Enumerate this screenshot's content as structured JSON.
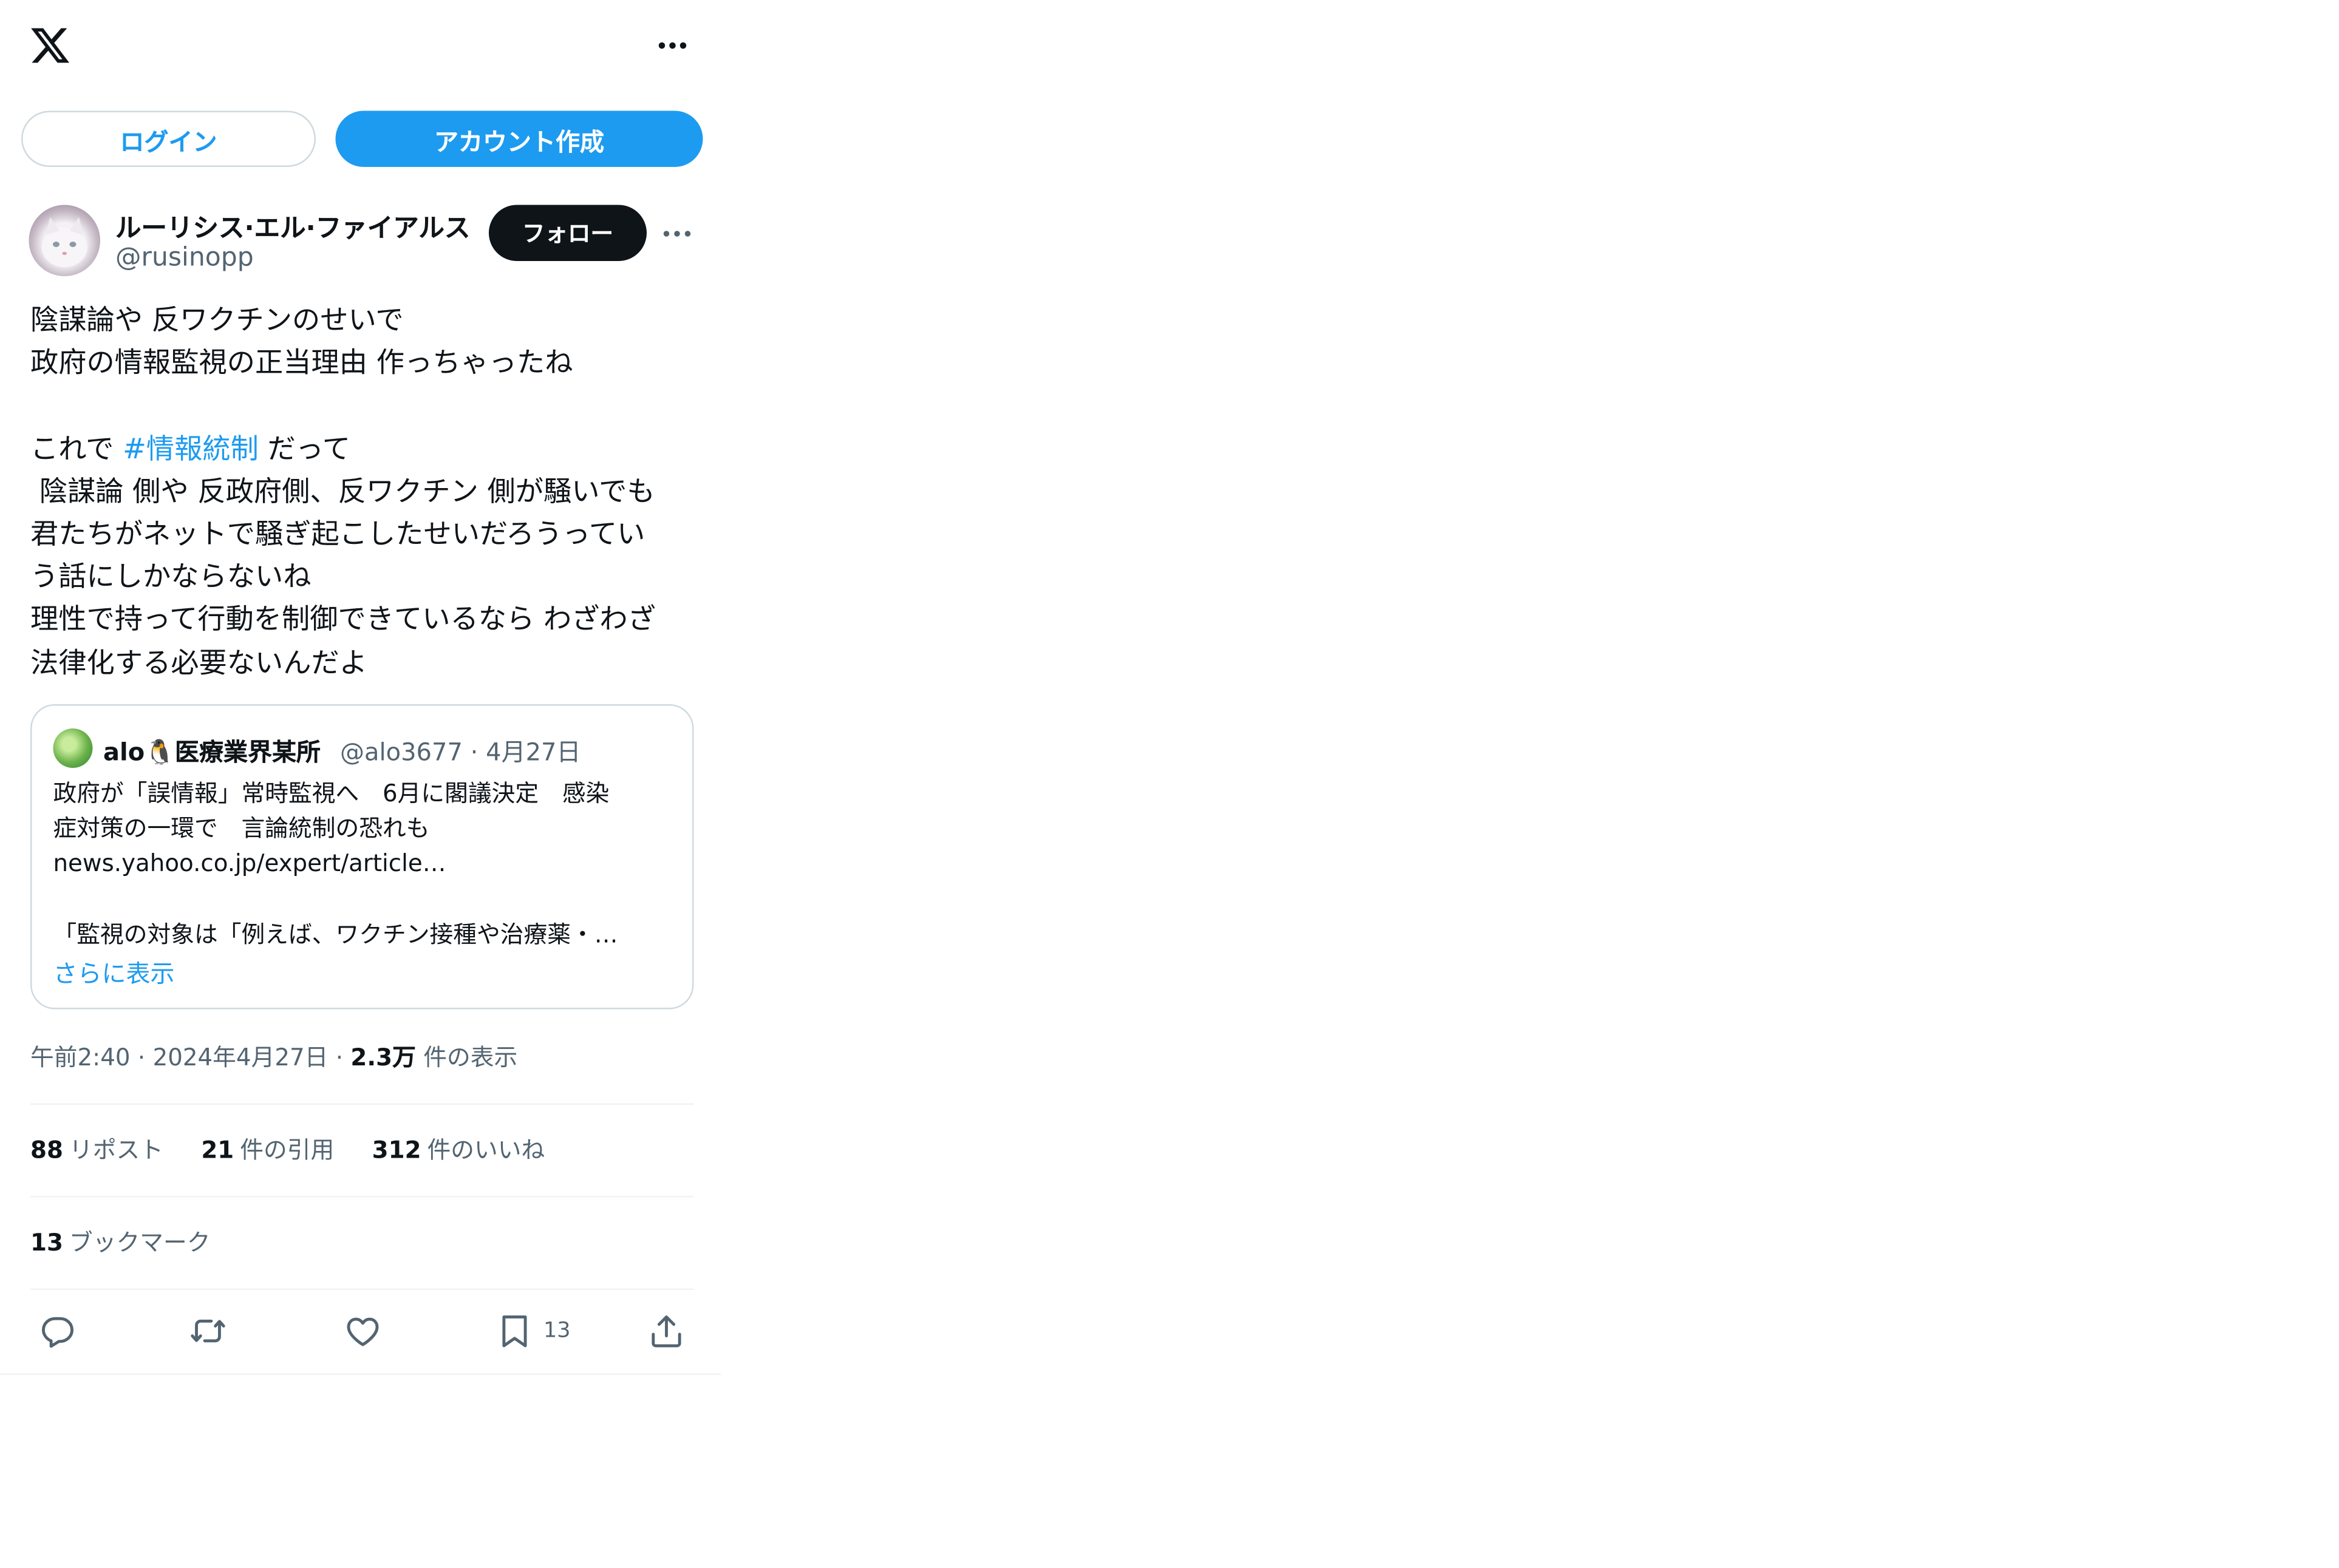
{
  "header": {
    "logo_icon": "x-logo-icon",
    "more_icon": "more-horizontal-icon"
  },
  "auth": {
    "login_label": "ログイン",
    "signup_label": "アカウント作成"
  },
  "post": {
    "author": {
      "display_name": "ルーリシス·エル·ファイアルス",
      "handle": "@rusinopp"
    },
    "follow_label": "フォロー",
    "body": {
      "line1": "陰謀論や 反ワクチンのせいで",
      "line2": "政府の情報監視の正当理由 作っちゃったね",
      "line3_before": "これで ",
      "hashtag": "#情報統制",
      "line3_after": " だって",
      "line4": " 陰謀論 側や 反政府側、反ワクチン 側が騒いでも",
      "line5": "君たちがネットで騒ぎ起こしたせいだろうってい",
      "line6": "う話にしかならないね",
      "line7": "理性で持って行動を制御できているなら わざわざ",
      "line8": "法律化する必要ないんだよ"
    },
    "quote": {
      "name": "alo🐧医療業界某所",
      "handle": "@alo3677",
      "separator": "·",
      "date": "4月27日",
      "line1": "政府が「誤情報」常時監視へ　6月に閣議決定　感染",
      "line2": "症対策の一環で　言論統制の恐れも",
      "line3": "news.yahoo.co.jp/expert/article…",
      "line4": "「監視の対象は「例えば、ワクチン接種や治療薬・…",
      "show_more": "さらに表示"
    },
    "timestamp": {
      "time": "午前2:40",
      "dot1": "·",
      "date": "2024年4月27日",
      "dot2": "·",
      "views": "2.3万",
      "views_label": "件の表示"
    },
    "stats": {
      "reposts": "88",
      "reposts_label": "リポスト",
      "quotes": "21",
      "quotes_label": "件の引用",
      "likes": "312",
      "likes_label": "件のいいね",
      "bookmarks": "13",
      "bookmarks_label": "ブックマーク"
    },
    "actions": {
      "reply_icon": "reply-icon",
      "repost_icon": "repost-icon",
      "like_icon": "heart-icon",
      "bookmark_icon": "bookmark-icon",
      "bookmark_count": "13",
      "share_icon": "share-icon"
    }
  },
  "colors": {
    "accent": "#1d9bf0",
    "text": "#0f1419",
    "muted": "#536471",
    "border": "#cfd9de",
    "divider": "#eff3f4"
  }
}
